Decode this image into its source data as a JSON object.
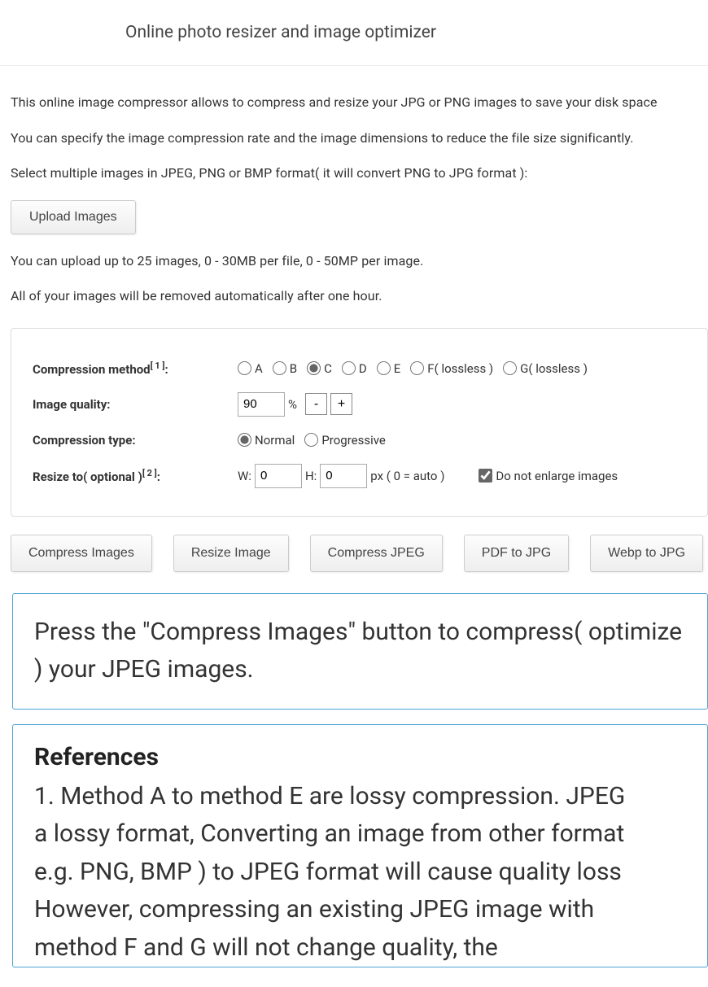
{
  "header": {
    "title": "Online photo resizer and image optimizer"
  },
  "intro": {
    "p1": "This online image compressor allows to compress and resize your JPG or PNG images to save your disk space",
    "p2": "You can specify the image compression rate and the image dimensions to reduce the file size significantly.",
    "p3": "Select multiple images in JPEG, PNG or BMP format( it will convert PNG to JPG format ):"
  },
  "upload": {
    "button": "Upload Images"
  },
  "limits": {
    "p1": "You can upload up to 25 images, 0 - 30MB per file, 0 - 50MP per image.",
    "p2": "All of your images will be removed automatically after one hour."
  },
  "options": {
    "method_label": "Compression method",
    "method_ref": "[ 1 ]",
    "methods": {
      "a": "A",
      "b": "B",
      "c": "C",
      "d": "D",
      "e": "E",
      "f": "F( lossless )",
      "g": "G( lossless )"
    },
    "method_selected": "c",
    "quality_label": "Image quality:",
    "quality_value": "90",
    "percent": "%",
    "minus": "-",
    "plus": "+",
    "type_label": "Compression type:",
    "type_normal": "Normal",
    "type_progressive": "Progressive",
    "type_selected": "normal",
    "resize_label": "Resize to( optional )",
    "resize_ref": "[ 2 ]",
    "w_label": "W:",
    "h_label": "H:",
    "w_value": "0",
    "h_value": "0",
    "px_note": "px ( 0 = auto )",
    "no_enlarge": "Do not enlarge images",
    "no_enlarge_checked": true
  },
  "actions": {
    "compress": "Compress Images",
    "resize": "Resize Image",
    "compress_jpeg": "Compress JPEG",
    "pdf_to_jpg": "PDF to JPG",
    "webp_to_jpg": "Webp to JPG"
  },
  "info": {
    "text": "Press the \"Compress Images\" button to compress( optimize ) your JPEG images."
  },
  "references": {
    "heading": "References",
    "line1": "1. Method A to method E are lossy compression. JPEG",
    "line2": "a lossy format, Converting an image from other format",
    "line3": "e.g. PNG, BMP ) to JPEG format will cause quality loss",
    "line4": "However, compressing an existing JPEG image with",
    "line5": "method F and G will not change quality, the"
  }
}
